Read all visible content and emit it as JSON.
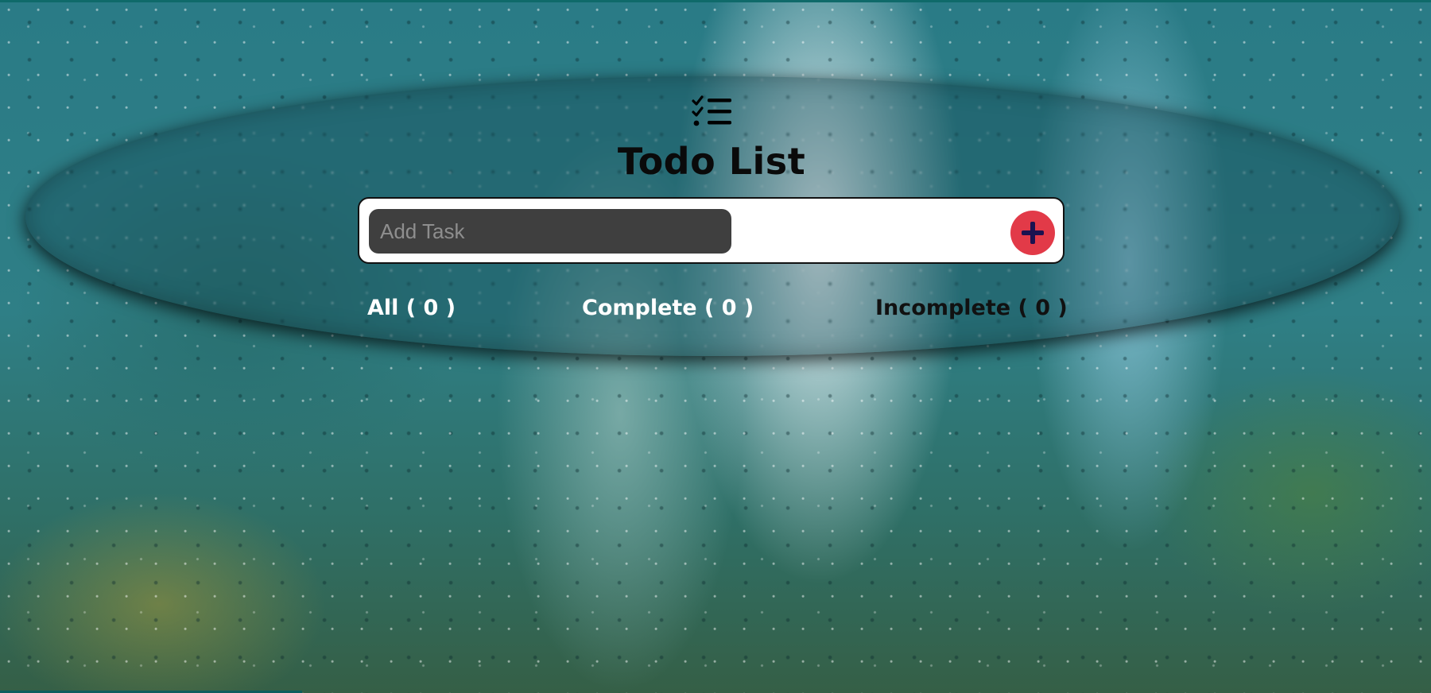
{
  "app": {
    "title": "Todo List",
    "logo_icon": "checklist-icon"
  },
  "add_task": {
    "placeholder": "Add Task",
    "value": "",
    "button_icon": "plus-icon",
    "button_color": "#e23a48",
    "plus_color": "#1b1250"
  },
  "filters": {
    "all_label": "All ( 0 )",
    "complete_label": "Complete ( 0 )",
    "incomplete_label": "Incomplete ( 0 )"
  }
}
